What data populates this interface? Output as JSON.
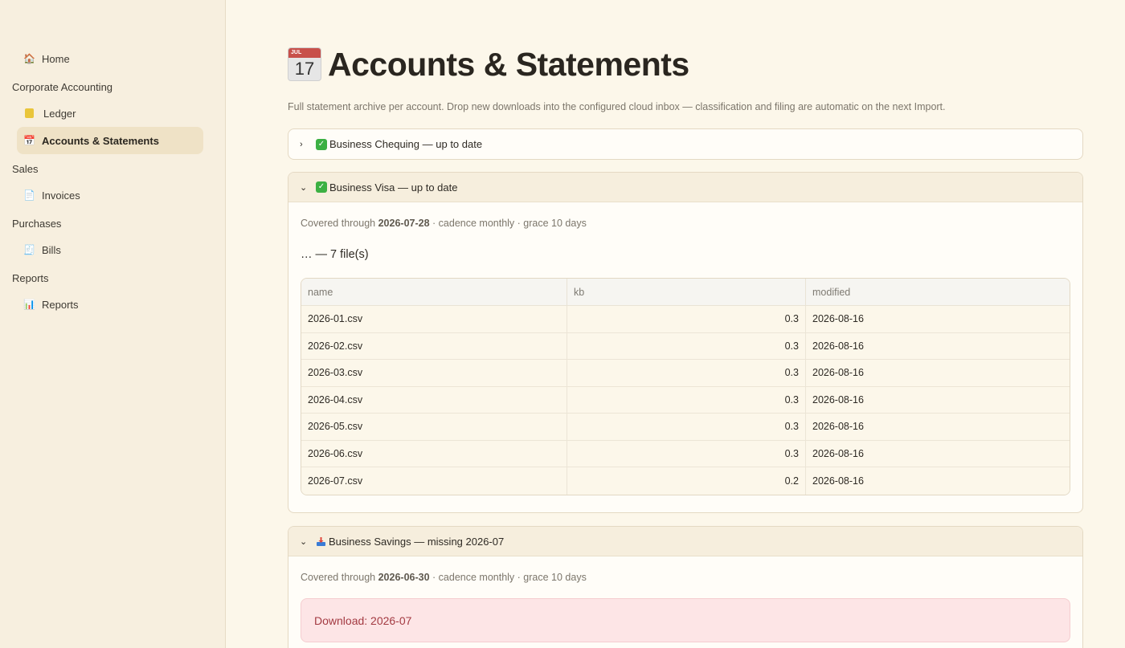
{
  "sidebar": {
    "home": {
      "label": "Home",
      "icon": "house-icon"
    },
    "sections": [
      {
        "title": "Corporate Accounting",
        "items": [
          {
            "label": "Ledger",
            "icon": "ledger-icon",
            "active": false
          },
          {
            "label": "Accounts & Statements",
            "icon": "calendar-icon",
            "active": true
          }
        ]
      },
      {
        "title": "Sales",
        "items": [
          {
            "label": "Invoices",
            "icon": "document-icon",
            "active": false
          }
        ]
      },
      {
        "title": "Purchases",
        "items": [
          {
            "label": "Bills",
            "icon": "receipt-icon",
            "active": false
          }
        ]
      },
      {
        "title": "Reports",
        "items": [
          {
            "label": "Reports",
            "icon": "bar-chart-icon",
            "active": false
          }
        ]
      }
    ]
  },
  "page": {
    "title": "Accounts & Statements",
    "calendar_icon": {
      "month": "JUL",
      "day": "17"
    },
    "subtitle": "Full statement archive per account. Drop new downloads into the configured cloud inbox — classification and filing are automatic on the next Import."
  },
  "accounts": [
    {
      "label": "Business Chequing — up to date",
      "expanded": false,
      "status_icon": "check-icon"
    },
    {
      "label": "Business Visa — up to date",
      "expanded": true,
      "status_icon": "check-icon",
      "covered_prefix": "Covered through",
      "covered_date": "2026-07-28",
      "covered_suffix": "· cadence monthly · grace 10 days",
      "files_heading": "… — 7 file(s)",
      "columns": [
        "name",
        "kb",
        "modified"
      ],
      "rows": [
        {
          "name": "2026-01.csv",
          "kb": "0.3",
          "modified": "2026-08-16"
        },
        {
          "name": "2026-02.csv",
          "kb": "0.3",
          "modified": "2026-08-16"
        },
        {
          "name": "2026-03.csv",
          "kb": "0.3",
          "modified": "2026-08-16"
        },
        {
          "name": "2026-04.csv",
          "kb": "0.3",
          "modified": "2026-08-16"
        },
        {
          "name": "2026-05.csv",
          "kb": "0.3",
          "modified": "2026-08-16"
        },
        {
          "name": "2026-06.csv",
          "kb": "0.3",
          "modified": "2026-08-16"
        },
        {
          "name": "2026-07.csv",
          "kb": "0.2",
          "modified": "2026-08-16"
        }
      ]
    },
    {
      "label": "Business Savings — missing 2026-07",
      "expanded": true,
      "status_icon": "inbox-icon",
      "covered_prefix": "Covered through",
      "covered_date": "2026-06-30",
      "covered_suffix": "· cadence monthly · grace 10 days",
      "alert": "Download: 2026-07"
    }
  ],
  "colors": {
    "accent_bg": "#efe2c6",
    "alert_text": "#a33a42",
    "alert_bg": "#fde5e6",
    "check": "#3cb043"
  }
}
